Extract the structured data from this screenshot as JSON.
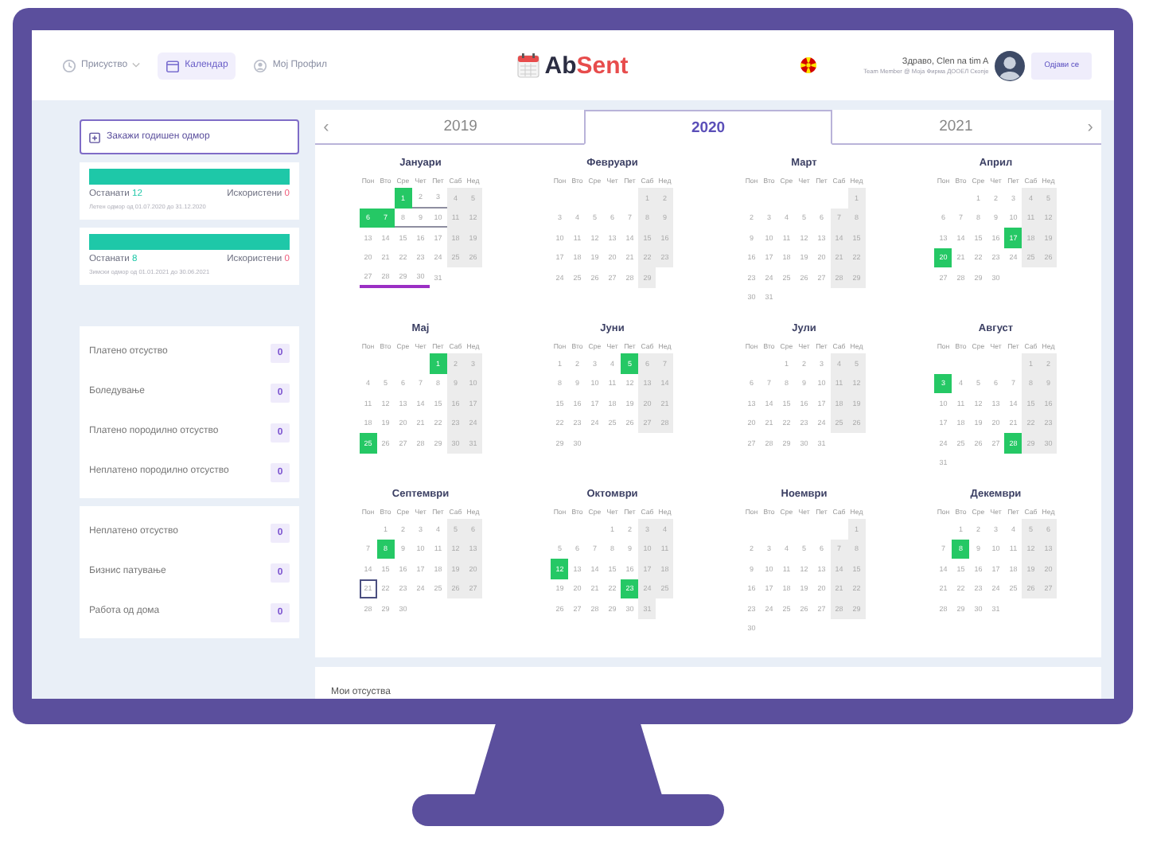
{
  "nav": {
    "items": [
      {
        "label": "Присуство",
        "dropdown": true,
        "selected": false
      },
      {
        "label": "Календар",
        "dropdown": false,
        "selected": true
      },
      {
        "label": "Мој Профил",
        "dropdown": false,
        "selected": false
      }
    ]
  },
  "logo": {
    "prefix": "Ab",
    "suffix": "Sent"
  },
  "user": {
    "greeting": "Здраво, Clen na tim A",
    "role": "Team Member @ Моја Фирма ДООЕЛ Скопје",
    "logout": "Одјави се"
  },
  "sidebar": {
    "book_button": "Закажи годишен одмор",
    "balances": [
      {
        "level": 1,
        "remaining_label": "Останати",
        "remaining": "12",
        "used_label": "Искористени",
        "used": "0",
        "period": "Летен одмор од 01.07.2020 до 31.12.2020"
      },
      {
        "level": 1,
        "remaining_label": "Останати",
        "remaining": "8",
        "used_label": "Искористени",
        "used": "0",
        "period": "Зимски одмор од 01.01.2021 до 30.06.2021"
      }
    ],
    "groups": [
      [
        {
          "label": "Платено отсуство",
          "count": "0"
        },
        {
          "label": "Боледување",
          "count": "0"
        },
        {
          "label": "Платено породилно отсуство",
          "count": "0"
        },
        {
          "label": "Неплатено породилно отсуство",
          "count": "0"
        }
      ],
      [
        {
          "label": "Неплатено отсуство",
          "count": "0"
        },
        {
          "label": "Бизнис патување",
          "count": "0"
        },
        {
          "label": "Работа од дома",
          "count": "0"
        }
      ]
    ]
  },
  "calendar": {
    "prev": "‹",
    "next": "›",
    "years": [
      {
        "label": "2019",
        "selected": false
      },
      {
        "label": "2020",
        "selected": true
      },
      {
        "label": "2021",
        "selected": false
      }
    ],
    "months": [
      {
        "name": "Јануари",
        "weekdays": [
          "Пон",
          "Вто",
          "Сре",
          "Чет",
          "Пет",
          "Саб",
          "Нед"
        ],
        "days": [
          {
            "kind": "blank"
          },
          {
            "kind": "blank"
          },
          {
            "day": "1",
            "kind": "leave"
          },
          {
            "day": "2",
            "kind": "pending"
          },
          {
            "day": "3",
            "kind": "pending"
          },
          "4",
          "5",
          {
            "day": "6",
            "kind": "leave"
          },
          {
            "day": "7",
            "kind": "leave"
          },
          {
            "day": "8",
            "kind": "pending"
          },
          {
            "day": "9",
            "kind": "pending"
          },
          {
            "day": "10",
            "kind": "pending"
          },
          "11",
          "12",
          "13",
          "14",
          "15",
          "16",
          "17",
          "18",
          "19",
          "20",
          "21",
          "22",
          "23",
          "24",
          "25",
          "26",
          {
            "day": "27",
            "kind": "requested"
          },
          {
            "day": "28",
            "kind": "requested"
          },
          {
            "day": "29",
            "kind": "requested"
          },
          {
            "day": "30",
            "kind": "requested"
          },
          "31"
        ]
      },
      {
        "name": "Февруари",
        "weekdays": [
          "Пон",
          "Вто",
          "Сре",
          "Чет",
          "Пет",
          "Саб",
          "Нед"
        ],
        "days": [
          {
            "kind": "blank"
          },
          {
            "kind": "blank"
          },
          {
            "kind": "blank"
          },
          {
            "kind": "blank"
          },
          {
            "kind": "blank"
          },
          "1",
          "2",
          "3",
          "4",
          "5",
          "6",
          "7",
          "8",
          "9",
          "10",
          "11",
          "12",
          "13",
          "14",
          "15",
          "16",
          "17",
          "18",
          "19",
          "20",
          "21",
          "22",
          "23",
          "24",
          "25",
          "26",
          "27",
          "28",
          "29"
        ]
      },
      {
        "name": "Март",
        "weekdays": [
          "Пон",
          "Вто",
          "Сре",
          "Чет",
          "Пет",
          "Саб",
          "Нед"
        ],
        "days": [
          {
            "kind": "blank"
          },
          {
            "kind": "blank"
          },
          {
            "kind": "blank"
          },
          {
            "kind": "blank"
          },
          {
            "kind": "blank"
          },
          {
            "kind": "blank"
          },
          "1",
          "2",
          "3",
          "4",
          "5",
          "6",
          "7",
          "8",
          "9",
          "10",
          "11",
          "12",
          "13",
          "14",
          "15",
          "16",
          "17",
          "18",
          "19",
          "20",
          "21",
          "22",
          "23",
          "24",
          "25",
          "26",
          "27",
          "28",
          "29",
          "30",
          "31"
        ]
      },
      {
        "name": "Април",
        "weekdays": [
          "Пон",
          "Вто",
          "Сре",
          "Чет",
          "Пет",
          "Саб",
          "Нед"
        ],
        "days": [
          {
            "kind": "blank"
          },
          {
            "kind": "blank"
          },
          "1",
          "2",
          "3",
          "4",
          "5",
          "6",
          "7",
          "8",
          "9",
          "10",
          "11",
          "12",
          "13",
          "14",
          "15",
          "16",
          {
            "day": "17",
            "kind": "leave"
          },
          "18",
          "19",
          {
            "day": "20",
            "kind": "leave"
          },
          "21",
          "22",
          "23",
          "24",
          "25",
          "26",
          "27",
          "28",
          "29",
          "30"
        ]
      },
      {
        "name": "Мај",
        "weekdays": [
          "Пон",
          "Вто",
          "Сре",
          "Чет",
          "Пет",
          "Саб",
          "Нед"
        ],
        "days": [
          {
            "kind": "blank"
          },
          {
            "kind": "blank"
          },
          {
            "kind": "blank"
          },
          {
            "kind": "blank"
          },
          {
            "day": "1",
            "kind": "leave"
          },
          "2",
          "3",
          "4",
          "5",
          "6",
          "7",
          "8",
          "9",
          "10",
          "11",
          "12",
          "13",
          "14",
          "15",
          "16",
          "17",
          "18",
          "19",
          "20",
          "21",
          "22",
          "23",
          "24",
          {
            "day": "25",
            "kind": "leave"
          },
          "26",
          "27",
          "28",
          "29",
          "30",
          "31"
        ]
      },
      {
        "name": "Јуни",
        "weekdays": [
          "Пон",
          "Вто",
          "Сре",
          "Чет",
          "Пет",
          "Саб",
          "Нед"
        ],
        "days": [
          "1",
          "2",
          "3",
          "4",
          {
            "day": "5",
            "kind": "leave"
          },
          "6",
          "7",
          "8",
          "9",
          "10",
          "11",
          "12",
          "13",
          "14",
          "15",
          "16",
          "17",
          "18",
          "19",
          "20",
          "21",
          "22",
          "23",
          "24",
          "25",
          "26",
          "27",
          "28",
          "29",
          "30"
        ]
      },
      {
        "name": "Јули",
        "weekdays": [
          "Пон",
          "Вто",
          "Сре",
          "Чет",
          "Пет",
          "Саб",
          "Нед"
        ],
        "days": [
          {
            "kind": "blank"
          },
          {
            "kind": "blank"
          },
          "1",
          "2",
          "3",
          "4",
          "5",
          "6",
          "7",
          "8",
          "9",
          "10",
          "11",
          "12",
          "13",
          "14",
          "15",
          "16",
          "17",
          "18",
          "19",
          "20",
          "21",
          "22",
          "23",
          "24",
          "25",
          "26",
          "27",
          "28",
          "29",
          "30",
          "31"
        ]
      },
      {
        "name": "Август",
        "weekdays": [
          "Пон",
          "Вто",
          "Сре",
          "Чет",
          "Пет",
          "Саб",
          "Нед"
        ],
        "days": [
          {
            "kind": "blank"
          },
          {
            "kind": "blank"
          },
          {
            "kind": "blank"
          },
          {
            "kind": "blank"
          },
          {
            "kind": "blank"
          },
          "1",
          "2",
          {
            "day": "3",
            "kind": "leave"
          },
          "4",
          "5",
          "6",
          "7",
          "8",
          "9",
          "10",
          "11",
          "12",
          "13",
          "14",
          "15",
          "16",
          "17",
          "18",
          "19",
          "20",
          "21",
          "22",
          "23",
          "24",
          "25",
          "26",
          "27",
          {
            "day": "28",
            "kind": "leave"
          },
          "29",
          "30",
          "31"
        ]
      },
      {
        "name": "Септември",
        "weekdays": [
          "Пон",
          "Вто",
          "Сре",
          "Чет",
          "Пет",
          "Саб",
          "Нед"
        ],
        "days": [
          {
            "kind": "blank"
          },
          "1",
          "2",
          "3",
          "4",
          "5",
          "6",
          "7",
          {
            "day": "8",
            "kind": "leave"
          },
          "9",
          "10",
          "11",
          "12",
          "13",
          "14",
          "15",
          "16",
          "17",
          "18",
          "19",
          "20",
          {
            "day": "21",
            "kind": "today"
          },
          "22",
          "23",
          "24",
          "25",
          "26",
          "27",
          "28",
          "29",
          "30"
        ]
      },
      {
        "name": "Октомври",
        "weekdays": [
          "Пон",
          "Вто",
          "Сре",
          "Чет",
          "Пет",
          "Саб",
          "Нед"
        ],
        "days": [
          {
            "kind": "blank"
          },
          {
            "kind": "blank"
          },
          {
            "kind": "blank"
          },
          "1",
          "2",
          "3",
          "4",
          "5",
          "6",
          "7",
          "8",
          "9",
          "10",
          "11",
          {
            "day": "12",
            "kind": "leave"
          },
          "13",
          "14",
          "15",
          "16",
          "17",
          "18",
          "19",
          "20",
          "21",
          "22",
          {
            "day": "23",
            "kind": "leave"
          },
          "24",
          "25",
          "26",
          "27",
          "28",
          "29",
          "30",
          "31"
        ]
      },
      {
        "name": "Ноември",
        "weekdays": [
          "Пон",
          "Вто",
          "Сре",
          "Чет",
          "Пет",
          "Саб",
          "Нед"
        ],
        "days": [
          {
            "kind": "blank"
          },
          {
            "kind": "blank"
          },
          {
            "kind": "blank"
          },
          {
            "kind": "blank"
          },
          {
            "kind": "blank"
          },
          {
            "kind": "blank"
          },
          "1",
          "2",
          "3",
          "4",
          "5",
          "6",
          "7",
          "8",
          "9",
          "10",
          "11",
          "12",
          "13",
          "14",
          "15",
          "16",
          "17",
          "18",
          "19",
          "20",
          "21",
          "22",
          "23",
          "24",
          "25",
          "26",
          "27",
          "28",
          "29",
          "30"
        ]
      },
      {
        "name": "Декември",
        "weekdays": [
          "Пон",
          "Вто",
          "Сре",
          "Чет",
          "Пет",
          "Саб",
          "Нед"
        ],
        "days": [
          {
            "kind": "blank"
          },
          "1",
          "2",
          "3",
          "4",
          "5",
          "6",
          "7",
          {
            "day": "8",
            "kind": "leave"
          },
          "9",
          "10",
          "11",
          "12",
          "13",
          "14",
          "15",
          "16",
          "17",
          "18",
          "19",
          "20",
          "21",
          "22",
          "23",
          "24",
          "25",
          "26",
          "27",
          "28",
          "29",
          "30",
          "31"
        ]
      }
    ]
  },
  "my_absences": {
    "title": "Мои отсуства"
  }
}
